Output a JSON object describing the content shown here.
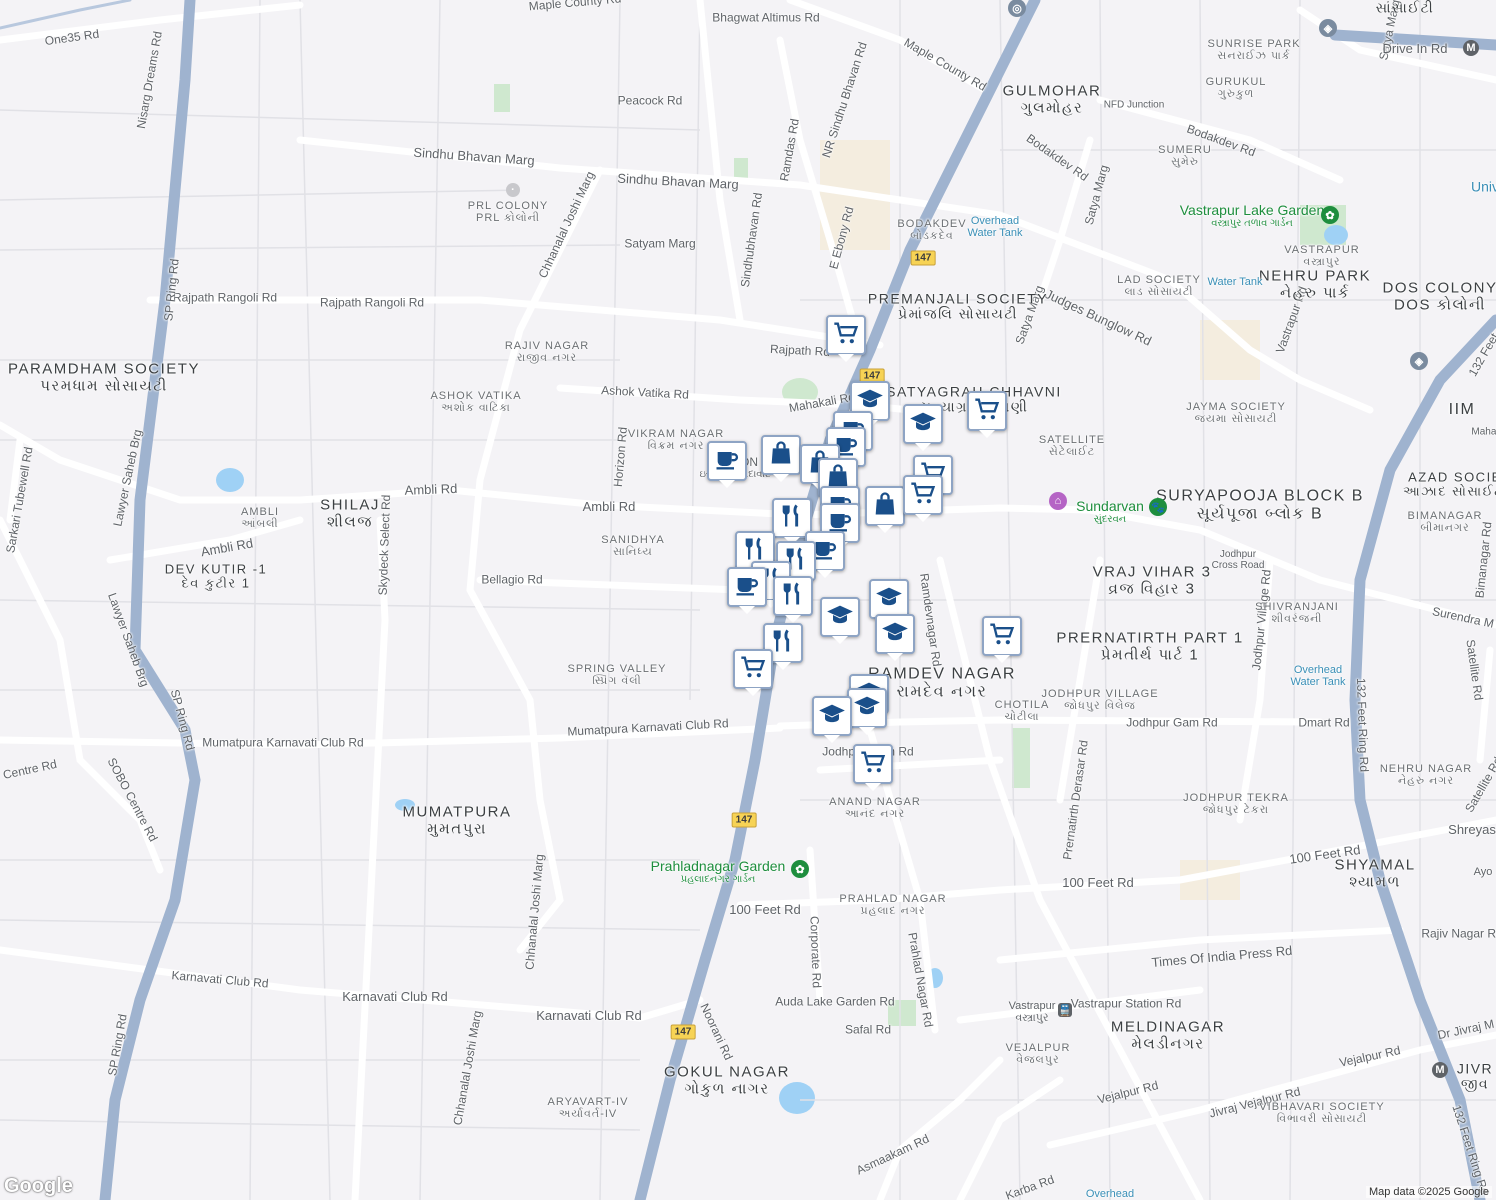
{
  "roads": [
    {
      "label": "One35 Rd"
    },
    {
      "label": "Nisarg Dreams Rd"
    },
    {
      "label": "Maple County Rd"
    },
    {
      "label": "Bhagwat Altimus Rd"
    },
    {
      "label": "Peacock Rd"
    },
    {
      "label": "Sindhu Bhavan Marg"
    },
    {
      "label": "Sindhu Bhavan Marg"
    },
    {
      "label": "Ramdas Rd"
    },
    {
      "label": "NR Sindhu Bhavan Rd"
    },
    {
      "label": "Maple County Rd"
    },
    {
      "label": "Chhanalal Joshi Marg"
    },
    {
      "label": "Satyam Marg"
    },
    {
      "label": "Sindhubhavan Rd"
    },
    {
      "label": "E Ebony Rd"
    },
    {
      "label": "Rajpath Rangoli Rd"
    },
    {
      "label": "Rajpath Rangoli Rd"
    },
    {
      "label": "Rajpath Rd"
    },
    {
      "label": "SP Ring Rd"
    },
    {
      "label": "Ashok Vatika Rd"
    },
    {
      "label": "Mahakali Rd"
    },
    {
      "label": "Horizon Rd"
    },
    {
      "label": "Ambli Rd"
    },
    {
      "label": "Ambli Rd"
    },
    {
      "label": "Ambli Rd"
    },
    {
      "label": "Sarkari Tubewell Rd"
    },
    {
      "label": "Lawyer Saheb Brg"
    },
    {
      "label": "Lawyer Saheb Brg"
    },
    {
      "label": "Skydeck Select Rd"
    },
    {
      "label": "Bellagio Rd"
    },
    {
      "label": "Mumatpura Karnavati Club Rd"
    },
    {
      "label": "Mumatpura Karnavati Club Rd"
    },
    {
      "label": "SP Ring Rd"
    },
    {
      "label": "SOBO Centre Rd"
    },
    {
      "label": "Centre Rd"
    },
    {
      "label": "Chhanalal Joshi Marg"
    },
    {
      "label": "Karnavati Club Rd"
    },
    {
      "label": "Karnavati Club Rd"
    },
    {
      "label": "Karnavati Club Rd"
    },
    {
      "label": "SP Ring Rd"
    },
    {
      "label": "Chhanalal Joshi Marg"
    },
    {
      "label": "Noorani Rd"
    },
    {
      "label": "100 Feet Rd"
    },
    {
      "label": "Corporate Rd"
    },
    {
      "label": "Prahlad Nagar Rd"
    },
    {
      "label": "Auda Lake Garden Rd"
    },
    {
      "label": "Safal Rd"
    },
    {
      "label": "Asmaakam Rd"
    },
    {
      "label": "Ramdevnagar Rd"
    },
    {
      "label": "Jodhpur Gam Rd"
    },
    {
      "label": "Jodhpur Gam Rd"
    },
    {
      "label": "Dmart Rd"
    },
    {
      "label": "Prernatirth Derasar Rd"
    },
    {
      "label": "Jodhpur Village Rd"
    },
    {
      "label": "132 Feet Ring Rd"
    },
    {
      "label": "132 Feet Ring Rd"
    },
    {
      "label": "100 Feet Rd"
    },
    {
      "label": "100 Feet Rd"
    },
    {
      "label": "Times Of India Press Rd"
    },
    {
      "label": "Vastrapur Station Rd"
    },
    {
      "label": "Vejalpur Rd"
    },
    {
      "label": "Vejalpur Rd"
    },
    {
      "label": "Jivraj Vejalpur Rd"
    },
    {
      "label": "Satellite Rd"
    },
    {
      "label": "Satellite Rd"
    },
    {
      "label": "Bimanagar Rd"
    },
    {
      "label": "Surendra M"
    },
    {
      "label": "Judges Bunglow Rd"
    },
    {
      "label": "Bodakdev Rd"
    },
    {
      "label": "Bodakdev Rd"
    },
    {
      "label": "Satya Marg"
    },
    {
      "label": "Satya Marg"
    },
    {
      "label": "Satya Marg"
    },
    {
      "label": "Vastrapur Rd"
    },
    {
      "label": "Drive In Rd"
    },
    {
      "label": "Rajiv Nagar Rd"
    },
    {
      "label": "Dr Jivraj M"
    },
    {
      "label": "132 Feet"
    },
    {
      "label": "Karba Rd"
    }
  ],
  "areas": [
    {
      "en": "PRL COLONY",
      "gu": "PRL કોલોની"
    },
    {
      "en": "RAJIV NAGAR",
      "gu": "રાજીવ નગર"
    },
    {
      "en": "ASHOK VATIKA",
      "gu": "અશોક વાટિકા"
    },
    {
      "en": "VIKRAM NAGAR",
      "gu": "વિક્રમ નગર"
    },
    {
      "en": "AMBLI",
      "gu": "આંબલી"
    },
    {
      "en": "SANIDHYA",
      "gu": "સાનિધ્ય"
    },
    {
      "en": "SPRING VALLEY",
      "gu": "સ્પ્રિંગ વૅલી"
    },
    {
      "en": "ANAND NAGAR",
      "gu": "આનંદ નગર"
    },
    {
      "en": "PRAHLAD NAGAR",
      "gu": "પ્રહલાદ નગર"
    },
    {
      "en": "ARYAVART-IV",
      "gu": "અર્યાવર્ત-IV"
    },
    {
      "en": "VEJALPUR",
      "gu": "વેજલપુર"
    },
    {
      "en": "SATELLITE",
      "gu": "સેટેલાઈટ"
    },
    {
      "en": "SUNRISE PARK",
      "gu": "સનરાઈઝ પાર્ક"
    },
    {
      "en": "GURUKUL",
      "gu": "ગુરુકુળ"
    },
    {
      "en": "SUMERU",
      "gu": "સુમેરુ"
    },
    {
      "en": "VASTRAPUR",
      "gu": "વસ્ત્રાપુર"
    },
    {
      "en": "LAD SOCIETY",
      "gu": "લાડ સોસાયટી"
    },
    {
      "en": "JAYMA SOCIETY",
      "gu": "જયમા સોસાયટી"
    },
    {
      "en": "BIMANAGAR",
      "gu": "બીમાનગર"
    },
    {
      "en": "SHIVRANJANI",
      "gu": "શીવરંજની"
    },
    {
      "en": "CHOTILA",
      "gu": "ચોટીલા"
    },
    {
      "en": "JODHPUR VILLAGE",
      "gu": "જોધપુર વિલેજ"
    },
    {
      "en": "JODHPUR TEKRA",
      "gu": "જોધપુર ટેકરા"
    },
    {
      "en": "NEHRU NAGAR",
      "gu": "નેહરુ નગર"
    },
    {
      "en": "VIBHAVARI SOCIETY",
      "gu": "વિભાવરી સોસાયટી"
    },
    {
      "en": "BODAKDEV",
      "gu": "બોડકદેવ"
    }
  ],
  "big_areas": [
    {
      "en": "PARAMDHAM SOCIETY",
      "gu": "પરમધામ સોસાયટી"
    },
    {
      "en": "SHILAJ",
      "gu": "શીલજ"
    },
    {
      "en": "DEV KUTIR -1",
      "gu": "દેવ કુટીર 1"
    },
    {
      "en": "MUMATPURA",
      "gu": "મુમતપુરા"
    },
    {
      "en": "PREMANJALI SOCIETY",
      "gu": "પ્રેમાંજલિ સોસાયટી"
    },
    {
      "en": "SATYAGRAH CHHAVNI",
      "gu": "સત્યાગ્રહ છાવણી"
    },
    {
      "en": "GULMOHAR",
      "gu": "ગુલમોહર"
    },
    {
      "en": "NEHRU PARK",
      "gu": "નેહરુ પાર્ક"
    },
    {
      "en": "DOS COLONY",
      "gu": "DOS કોલોની"
    },
    {
      "en": "SURYAPOOJA BLOCK B",
      "gu": "સૂર્યપૂજા બ્લોક B"
    },
    {
      "en": "VRAJ VIHAR 3",
      "gu": "વ્રજ વિહાર 3"
    },
    {
      "en": "PRERNATIRTH PART 1",
      "gu": "પ્રેમતીર્થ પાર્ટ 1"
    },
    {
      "en": "RAMDEV NAGAR",
      "gu": "રામદેવ નગર"
    },
    {
      "en": "GOKUL NAGAR",
      "gu": "ગોકુળ નાગર"
    },
    {
      "en": "MELDINAGAR",
      "gu": "મેલડીનગર"
    },
    {
      "en": "SHYAMAL",
      "gu": "શ્યામળ"
    },
    {
      "en": "AZAD SOCIE",
      "gu": "આઝાદ સોસાઈટી"
    },
    {
      "en": "IIM",
      "gu": ""
    },
    {
      "en": "JIVR",
      "gu": "જીવ"
    },
    {
      "en": "",
      "gu": "સાંસાઈટી"
    }
  ],
  "places": [
    {
      "label": "Vastrapur Lake Garden",
      "sub": "વસ્ત્રાપુર તળાવ ગાર્ડન"
    },
    {
      "label": "Prahladnagar Garden",
      "sub": "પ્રહલાદનગર ગાર્ડન"
    },
    {
      "label": "Sundarvan",
      "sub": "સુંદરવન"
    },
    {
      "label": "Overhead Water Tank",
      "sub": ""
    },
    {
      "label": "Water Tank",
      "sub": ""
    },
    {
      "label": "Overhead Water Tank",
      "sub": ""
    },
    {
      "label": "NFD Junction",
      "sub": ""
    },
    {
      "label": "Vastrapur",
      "sub": "વસ્ત્રાપુર"
    },
    {
      "label": "Jodhpur Cross Road",
      "sub": ""
    },
    {
      "label": "Univ",
      "sub": ""
    },
    {
      "label": "Shreyas",
      "sub": ""
    },
    {
      "label": "Ayo",
      "sub": ""
    },
    {
      "label": "Mahal",
      "sub": ""
    },
    {
      "label": "Overhead",
      "sub": ""
    },
    {
      "label": "ISKCON",
      "sub": "ઇસ્કોન અમદાવાદ"
    }
  ],
  "shields": [
    "147",
    "147",
    "147",
    "147"
  ],
  "pins": [
    {
      "icon": "cart-icon"
    },
    {
      "icon": "school-icon"
    },
    {
      "icon": "cafe-icon"
    },
    {
      "icon": "school-icon"
    },
    {
      "icon": "cart-icon"
    },
    {
      "icon": "cafe-icon"
    },
    {
      "icon": "bag-icon"
    },
    {
      "icon": "cafe-icon"
    },
    {
      "icon": "bag-icon"
    },
    {
      "icon": "bag-icon"
    },
    {
      "icon": "cart-icon"
    },
    {
      "icon": "cafe-icon"
    },
    {
      "icon": "bag-icon"
    },
    {
      "icon": "cart-icon"
    },
    {
      "icon": "cafe-icon"
    },
    {
      "icon": "food-icon"
    },
    {
      "icon": "food-icon"
    },
    {
      "icon": "cafe-icon"
    },
    {
      "icon": "food-icon"
    },
    {
      "icon": "food-icon"
    },
    {
      "icon": "cafe-icon"
    },
    {
      "icon": "food-icon"
    },
    {
      "icon": "school-icon"
    },
    {
      "icon": "school-icon"
    },
    {
      "icon": "school-icon"
    },
    {
      "icon": "cart-icon"
    },
    {
      "icon": "food-icon"
    },
    {
      "icon": "cart-icon"
    },
    {
      "icon": "school-icon"
    },
    {
      "icon": "school-icon"
    },
    {
      "icon": "school-icon"
    },
    {
      "icon": "cart-icon"
    }
  ],
  "logo": "Google",
  "attribution": "Map data ©2025 Google",
  "colors": {
    "highway": "#9fb3cf",
    "pin_border": "#8ea4c4",
    "pin_icon": "#1a4f8a",
    "park": "#c8e6c9",
    "water": "#9fd1f5"
  }
}
